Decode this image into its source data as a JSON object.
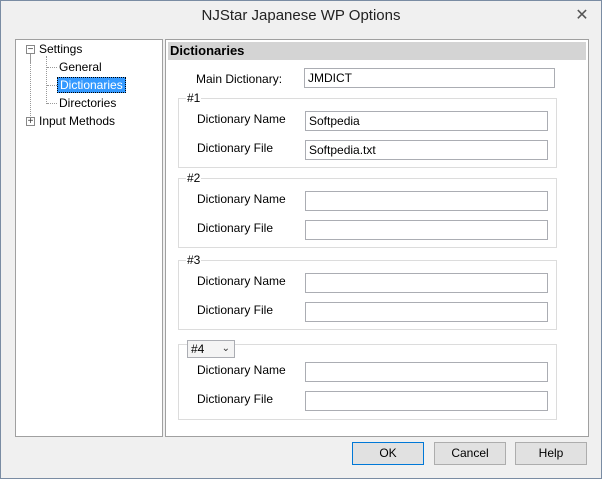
{
  "window": {
    "title": "NJStar Japanese WP Options"
  },
  "tree": {
    "settings": "Settings",
    "general": "General",
    "dictionaries": "Dictionaries",
    "directories": "Directories",
    "input_methods": "Input Methods",
    "expander_minus": "−",
    "expander_plus": "+"
  },
  "panel": {
    "header": "Dictionaries",
    "main_dictionary_label": "Main Dictionary:",
    "main_dictionary_value": "JMDICT",
    "groups": [
      {
        "title": "#1",
        "name_label": "Dictionary Name",
        "name_value": "Softpedia",
        "file_label": "Dictionary File",
        "file_value": "Softpedia.txt"
      },
      {
        "title": "#2",
        "name_label": "Dictionary Name",
        "name_value": "",
        "file_label": "Dictionary File",
        "file_value": ""
      },
      {
        "title": "#3",
        "name_label": "Dictionary Name",
        "name_value": "",
        "file_label": "Dictionary File",
        "file_value": ""
      },
      {
        "title": "#4",
        "name_label": "Dictionary Name",
        "name_value": "",
        "file_label": "Dictionary File",
        "file_value": ""
      }
    ]
  },
  "buttons": {
    "ok": "OK",
    "cancel": "Cancel",
    "help": "Help"
  },
  "icons": {
    "close": "✕",
    "dropdown": "⌄"
  }
}
